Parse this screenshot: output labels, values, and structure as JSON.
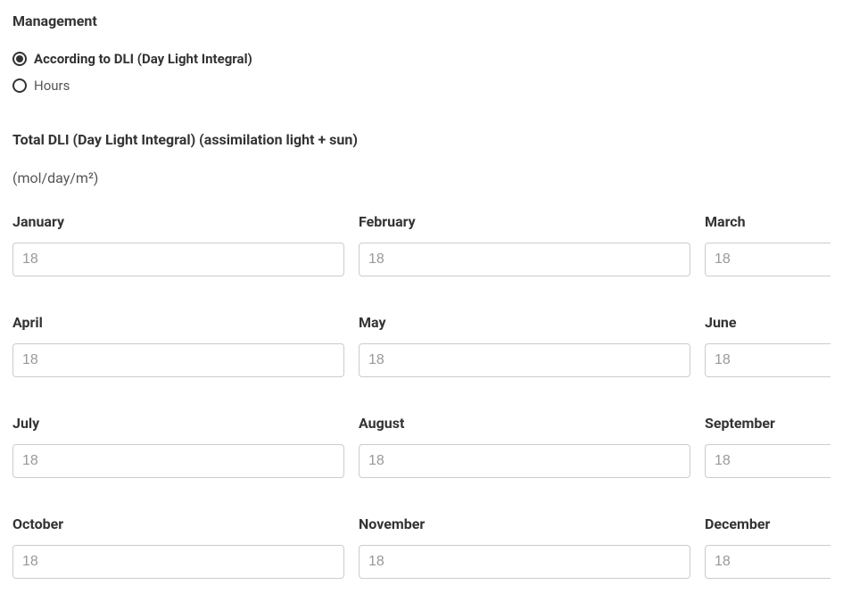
{
  "management": {
    "heading": "Management",
    "options": {
      "dli": "According to DLI (Day Light Integral)",
      "hours": "Hours"
    }
  },
  "dli_section": {
    "heading": "Total DLI (Day Light Integral) (assimilation light + sun)",
    "unit": "(mol/day/m²)"
  },
  "months": {
    "january": {
      "label": "January",
      "placeholder": "18"
    },
    "february": {
      "label": "February",
      "placeholder": "18"
    },
    "march": {
      "label": "March",
      "placeholder": "18"
    },
    "april": {
      "label": "April",
      "placeholder": "18"
    },
    "may": {
      "label": "May",
      "placeholder": "18"
    },
    "june": {
      "label": "June",
      "placeholder": "18"
    },
    "july": {
      "label": "July",
      "placeholder": "18"
    },
    "august": {
      "label": "August",
      "placeholder": "18"
    },
    "september": {
      "label": "September",
      "placeholder": "18"
    },
    "october": {
      "label": "October",
      "placeholder": "18"
    },
    "november": {
      "label": "November",
      "placeholder": "18"
    },
    "december": {
      "label": "December",
      "placeholder": "18"
    }
  }
}
